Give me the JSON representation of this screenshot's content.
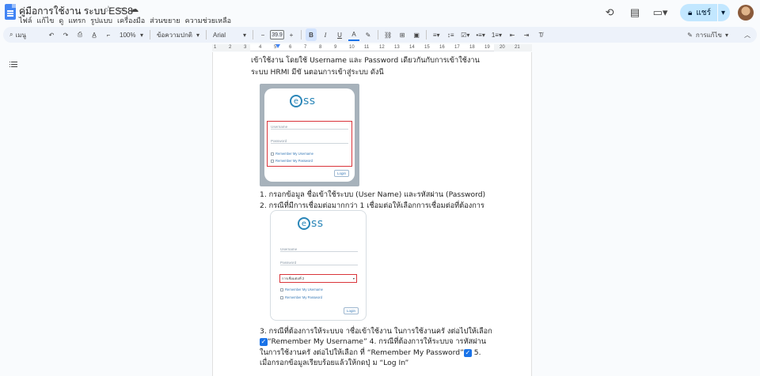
{
  "doc": {
    "title": "คู่มือการใช้งาน ระบบ ESS8"
  },
  "menu": [
    "ไฟล์",
    "แก้ไข",
    "ดู",
    "แทรก",
    "รูปแบบ",
    "เครื่องมือ",
    "ส่วนขยาย",
    "ความช่วยเหลือ"
  ],
  "top_right": {
    "share_label": "แชร์"
  },
  "toolbar": {
    "search_label": "เมนู",
    "zoom": "100%",
    "style": "ข้อความปกติ",
    "font": "Arial",
    "font_size": "39.9",
    "mode": "การแก้ไข"
  },
  "ruler_numbers": [
    "1",
    "2",
    "3",
    "4",
    "5",
    "6",
    "7",
    "8",
    "9",
    "10",
    "11",
    "12",
    "13",
    "14",
    "15",
    "16",
    "17",
    "18",
    "19",
    "20",
    "21"
  ],
  "content": {
    "line1": "เข้าใช้งาน โดยใช้ Username และ  Password เดียวกันกับการเข้าใช้งาน",
    "line2": "ระบบ HRMI มีขั นตอนการเข้าสู่ระบบ ดังนี",
    "item1": "1. กรอกข้อมูล ชื่อเข้าใช้ระบบ (User Name) และรหัสผ่าน (Password)",
    "item2": "2. กรณีที่มีการเชื่อมต่อมากกว่า 1 เชื่อมต่อให้เลือกการเชื่อมต่อที่ต้องการ",
    "item3a": "3. กรณีที่ต้องการให้ระบบจ าชื่อเข้าใช้งาน ในการใช้งานครั งต่อไปให้เลือก",
    "item3b": "“Remember My Username” 4. กรณีที่ต้องการให้ระบบจ ารหัสผ่าน",
    "item3c": "ในการใช้งานครั งต่อไปให้เลือก ที่ “Remember My Password”",
    "item3c_tail": " 5.",
    "item3d": "เมื่อกรอกข้อมูลเรียบร้อยแล้วให้กดปุ่ ม “Log In”"
  },
  "screens": {
    "logo_e": "e",
    "logo_ss": "ss",
    "username": "Username",
    "password": "Password",
    "remember_user": "Remember My Username",
    "remember_pass": "Remember My Password",
    "login": "Login",
    "connection": "การเชื่อมต่อที่ 2"
  }
}
